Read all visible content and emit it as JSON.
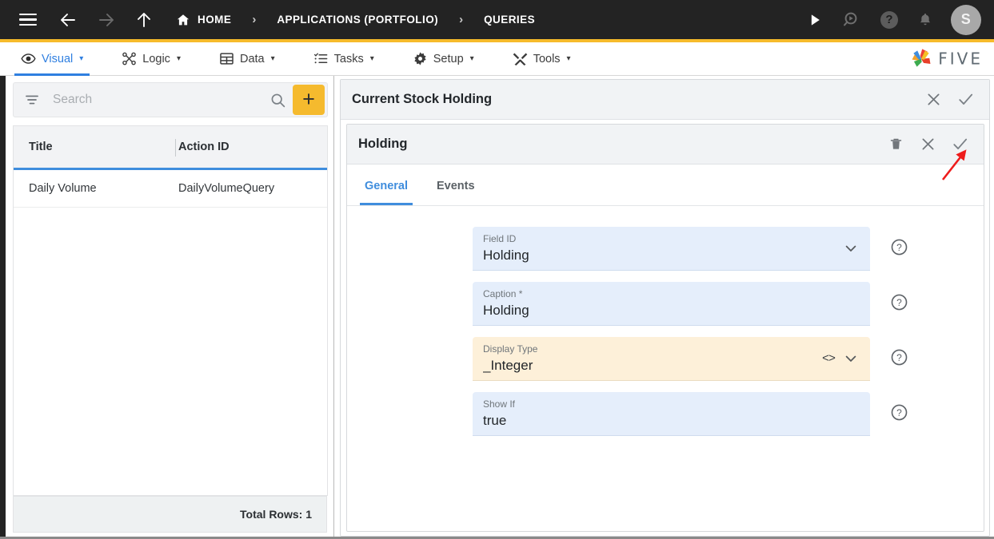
{
  "topbar": {
    "icons": {
      "menu": "hamburger-icon",
      "back": "back-arrow-icon",
      "forward": "forward-arrow-icon",
      "up": "up-arrow-icon",
      "run": "play-icon",
      "debug": "search-play-icon",
      "help": "help-icon",
      "notifications": "bell-icon"
    },
    "help_glyph": "?",
    "breadcrumb": [
      {
        "label": "HOME",
        "icon": "home-icon"
      },
      {
        "label": "APPLICATIONS (PORTFOLIO)",
        "icon": ""
      },
      {
        "label": "QUERIES",
        "icon": ""
      }
    ],
    "separator": "›",
    "avatar_initial": "S"
  },
  "menubar": {
    "items": [
      {
        "label": "Visual",
        "icon": "eye-icon",
        "caret": "▾",
        "active": true
      },
      {
        "label": "Logic",
        "icon": "logic-nodes-icon",
        "caret": "▾",
        "active": false
      },
      {
        "label": "Data",
        "icon": "table-icon",
        "caret": "▾",
        "active": false
      },
      {
        "label": "Tasks",
        "icon": "checklist-icon",
        "caret": "▾",
        "active": false
      },
      {
        "label": "Setup",
        "icon": "gear-icon",
        "caret": "▾",
        "active": false
      },
      {
        "label": "Tools",
        "icon": "tools-icon",
        "caret": "▾",
        "active": false
      }
    ],
    "brand": "FIVE"
  },
  "left_panel": {
    "search": {
      "placeholder": "Search",
      "value": "",
      "filter_icon": "filter-icon",
      "search_icon": "search-icon"
    },
    "add_button_label": "+",
    "columns": [
      "Title",
      "Action ID"
    ],
    "rows": [
      {
        "title": "Daily Volume",
        "action_id": "DailyVolumeQuery"
      }
    ],
    "footer": "Total Rows: 1"
  },
  "right_panel": {
    "outer": {
      "title": "Current Stock Holding",
      "actions": [
        {
          "name": "close-button",
          "glyph": "✕"
        },
        {
          "name": "confirm-button",
          "glyph": "✓"
        }
      ]
    },
    "inner": {
      "title": "Holding",
      "actions": [
        {
          "name": "delete-button",
          "glyph": "trash"
        },
        {
          "name": "close-button",
          "glyph": "✕"
        },
        {
          "name": "confirm-button",
          "glyph": "✓"
        }
      ],
      "tabs": [
        {
          "label": "General",
          "active": true
        },
        {
          "label": "Events",
          "active": false
        }
      ],
      "fields": [
        {
          "label": "Field ID",
          "value": "Holding",
          "style": "blue",
          "has_chevron": true,
          "has_code": false,
          "help": "?"
        },
        {
          "label": "Caption *",
          "value": "Holding",
          "style": "blue",
          "has_chevron": false,
          "has_code": false,
          "help": "?"
        },
        {
          "label": "Display Type",
          "value": "_Integer",
          "style": "amber",
          "has_chevron": true,
          "has_code": true,
          "code_glyph": "<>",
          "help": "?"
        },
        {
          "label": "Show If",
          "value": "true",
          "style": "blue",
          "has_chevron": false,
          "has_code": false,
          "help": "?"
        }
      ]
    }
  },
  "annotation": {
    "type": "arrow",
    "color": "#ee1c1c",
    "points_to": "inner-confirm-button"
  },
  "colors": {
    "topbar_bg": "#232323",
    "accent_amber": "#f6bb2b",
    "accent_blue": "#3f8ddd",
    "field_blue": "#e5eefb",
    "field_amber": "#fdf0d9",
    "annotation_red": "#ee1c1c"
  }
}
